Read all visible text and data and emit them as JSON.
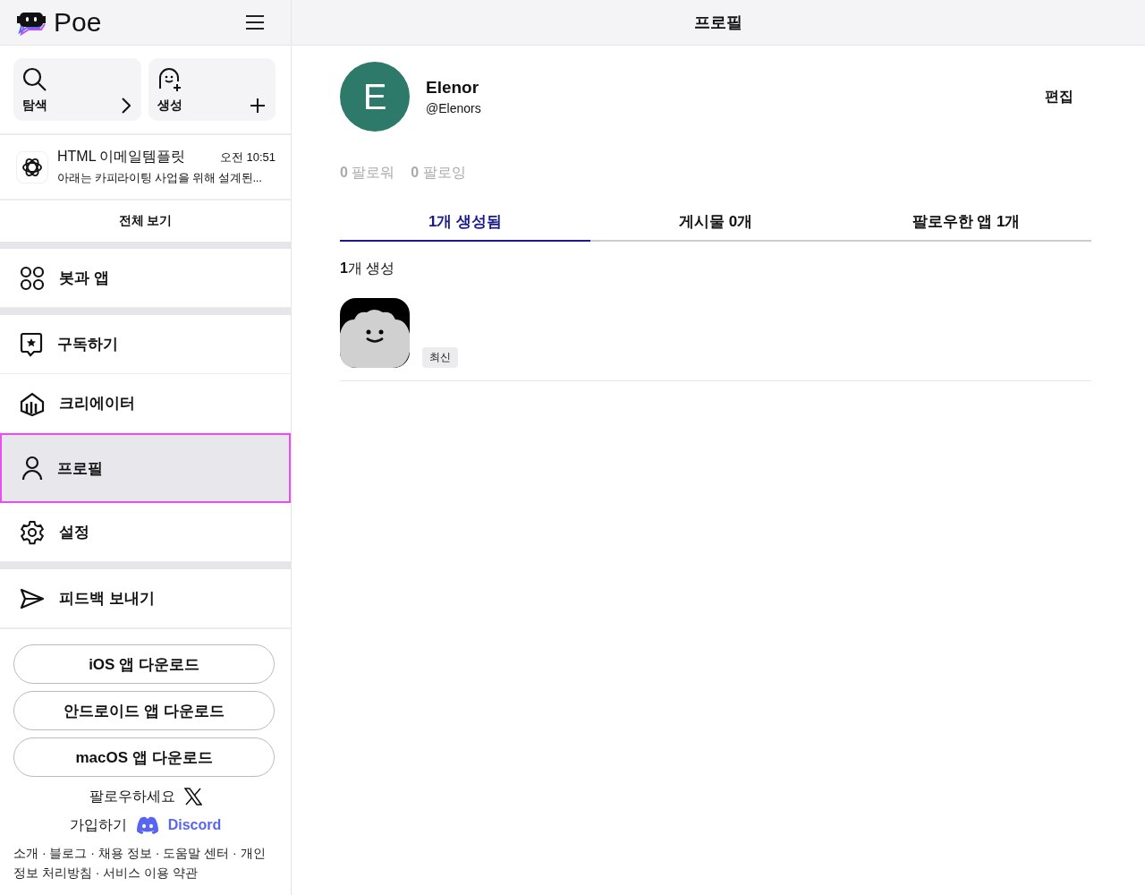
{
  "brand": {
    "name": "Poe"
  },
  "quick_actions": [
    {
      "label": "탐색",
      "kind": "explore"
    },
    {
      "label": "생성",
      "kind": "create"
    }
  ],
  "recent_chat": {
    "title": "HTML 이메일템플릿",
    "time": "오전 10:51",
    "preview": "아래는 카피라이팅 사업을 위해 설계된..."
  },
  "view_all": "전체 보기",
  "nav_groups": [
    [
      {
        "label": "봇과 앱",
        "kind": "bots",
        "selected": false
      }
    ],
    [
      {
        "label": "구독하기",
        "kind": "subscribe",
        "selected": false
      },
      {
        "label": "크리에이터",
        "kind": "creator",
        "selected": false
      },
      {
        "label": "프로필",
        "kind": "profile",
        "selected": true
      },
      {
        "label": "설정",
        "kind": "settings",
        "selected": false
      }
    ],
    [
      {
        "label": "피드백 보내기",
        "kind": "feedback",
        "selected": false
      }
    ]
  ],
  "download_buttons": [
    "iOS 앱 다운로드",
    "안드로이드 앱 다운로드",
    "macOS 앱 다운로드"
  ],
  "follow_x": "팔로우하세요",
  "join_discord": {
    "label": "가입하기",
    "brand": "Discord"
  },
  "footer": "소개 · 블로그 · 채용 정보 · 도움말 센터 · 개인정보 처리방침 · 서비스 이용 약관",
  "page_title": "프로필",
  "profile": {
    "initial": "E",
    "name": "Elenor",
    "handle": "@Elenors",
    "edit": "편집",
    "followers": {
      "count": "0",
      "label": "팔로워"
    },
    "following": {
      "count": "0",
      "label": "팔로잉"
    }
  },
  "tabs": [
    {
      "label": "1개 생성됨",
      "selected": true
    },
    {
      "label": "게시물 0개",
      "selected": false
    },
    {
      "label": "팔로우한 앱 1개",
      "selected": false
    }
  ],
  "section_title": {
    "count": "1",
    "label": "개 생성"
  },
  "bots": [
    {
      "badge": "최신"
    }
  ]
}
